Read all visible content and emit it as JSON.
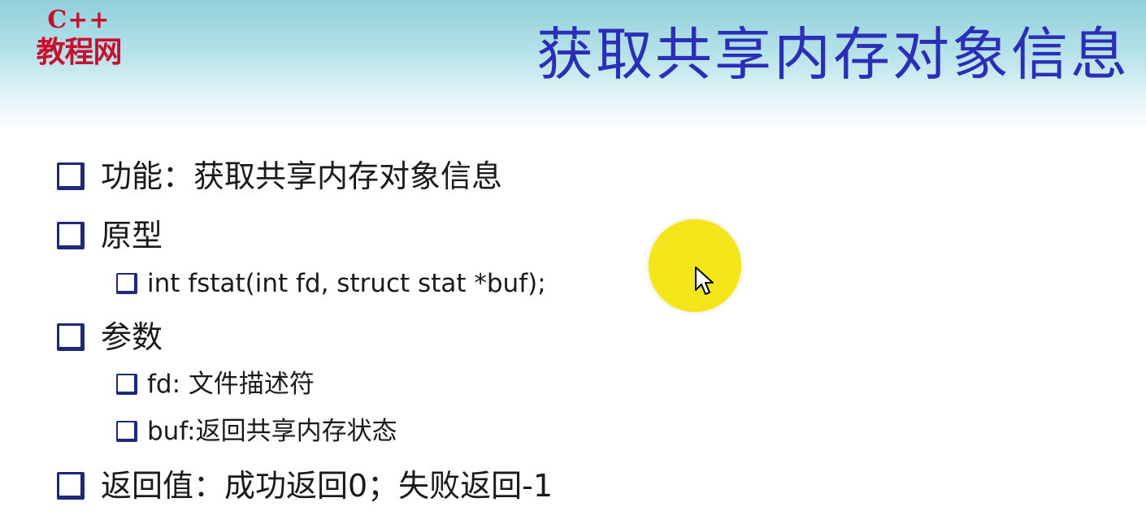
{
  "logo": {
    "top": "C++",
    "bottom": "教程网"
  },
  "title": "获取共享内存对象信息",
  "items": [
    {
      "level": 1,
      "text": "功能：获取共享内存对象信息"
    },
    {
      "level": 1,
      "text": "原型"
    },
    {
      "level": 2,
      "text": "int fstat(int fd, struct stat *buf);"
    },
    {
      "level": 1,
      "text": "参数"
    },
    {
      "level": 2,
      "text": "fd: 文件描述符"
    },
    {
      "level": 2,
      "text": "buf:返回共享内存状态"
    },
    {
      "level": 1,
      "text": "返回值：成功返回0；失败返回-1"
    }
  ],
  "colors": {
    "title": "#2b2fb8",
    "logo": "#c8102e",
    "bullet": "#1e2a78",
    "cursor_highlight": "#f4e41a"
  },
  "icons": {
    "bullet": "hollow-square-bullet-icon",
    "cursor": "mouse-pointer-icon"
  }
}
